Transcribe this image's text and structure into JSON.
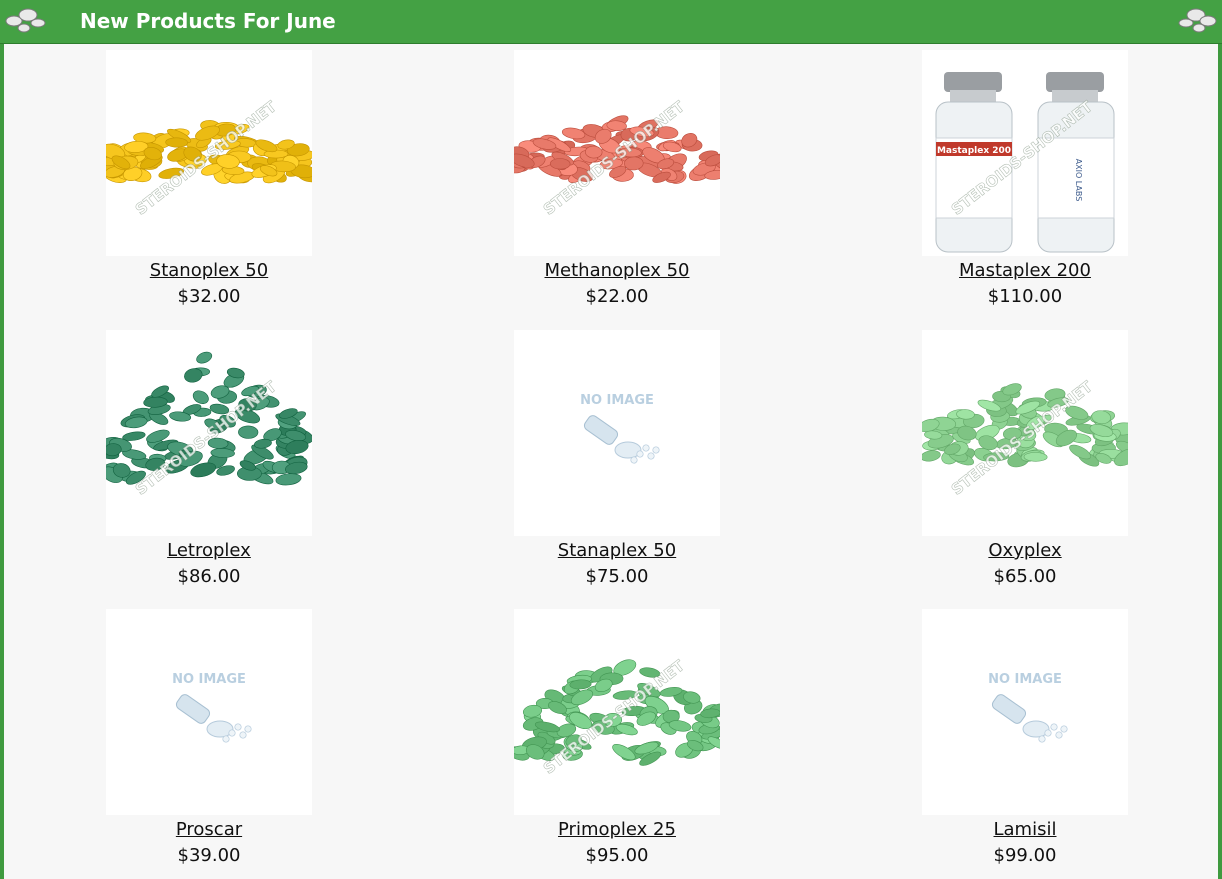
{
  "header": {
    "title": "New Products For June"
  },
  "products": [
    {
      "name": "Stanoplex 50",
      "price": "$32.00",
      "image": "yellow-pills-pile",
      "color": "#f2c21a"
    },
    {
      "name": "Methanoplex 50",
      "price": "$22.00",
      "image": "pink-pills-pile",
      "color": "#e87a6a"
    },
    {
      "name": "Mastaplex 200",
      "price": "$110.00",
      "image": "injectable-vials",
      "color": "#c8d3da"
    },
    {
      "name": "Letroplex",
      "price": "$86.00",
      "image": "dark-green-pills-pile",
      "color": "#3f8f6d"
    },
    {
      "name": "Stanaplex 50",
      "price": "$75.00",
      "image": "no-image-placeholder",
      "color": "#b9cfe0"
    },
    {
      "name": "Oxyplex",
      "price": "$65.00",
      "image": "light-green-pills-pile",
      "color": "#8fd494"
    },
    {
      "name": "Proscar",
      "price": "$39.00",
      "image": "no-image-placeholder",
      "color": "#b9cfe0"
    },
    {
      "name": "Primoplex 25",
      "price": "$95.00",
      "image": "green-pills-pile",
      "color": "#6fc27f"
    },
    {
      "name": "Lamisil",
      "price": "$99.00",
      "image": "no-image-placeholder",
      "color": "#b9cfe0"
    }
  ],
  "labels": {
    "no_image": "NO IMAGE",
    "watermark": "STEROIDS-SHOP.NET",
    "vial_label": "Mastaplex 200",
    "vial_brand": "AXIO LABS"
  },
  "colors": {
    "header": "#44a144",
    "border": "#3f9a3f",
    "background": "#f7f7f7"
  }
}
